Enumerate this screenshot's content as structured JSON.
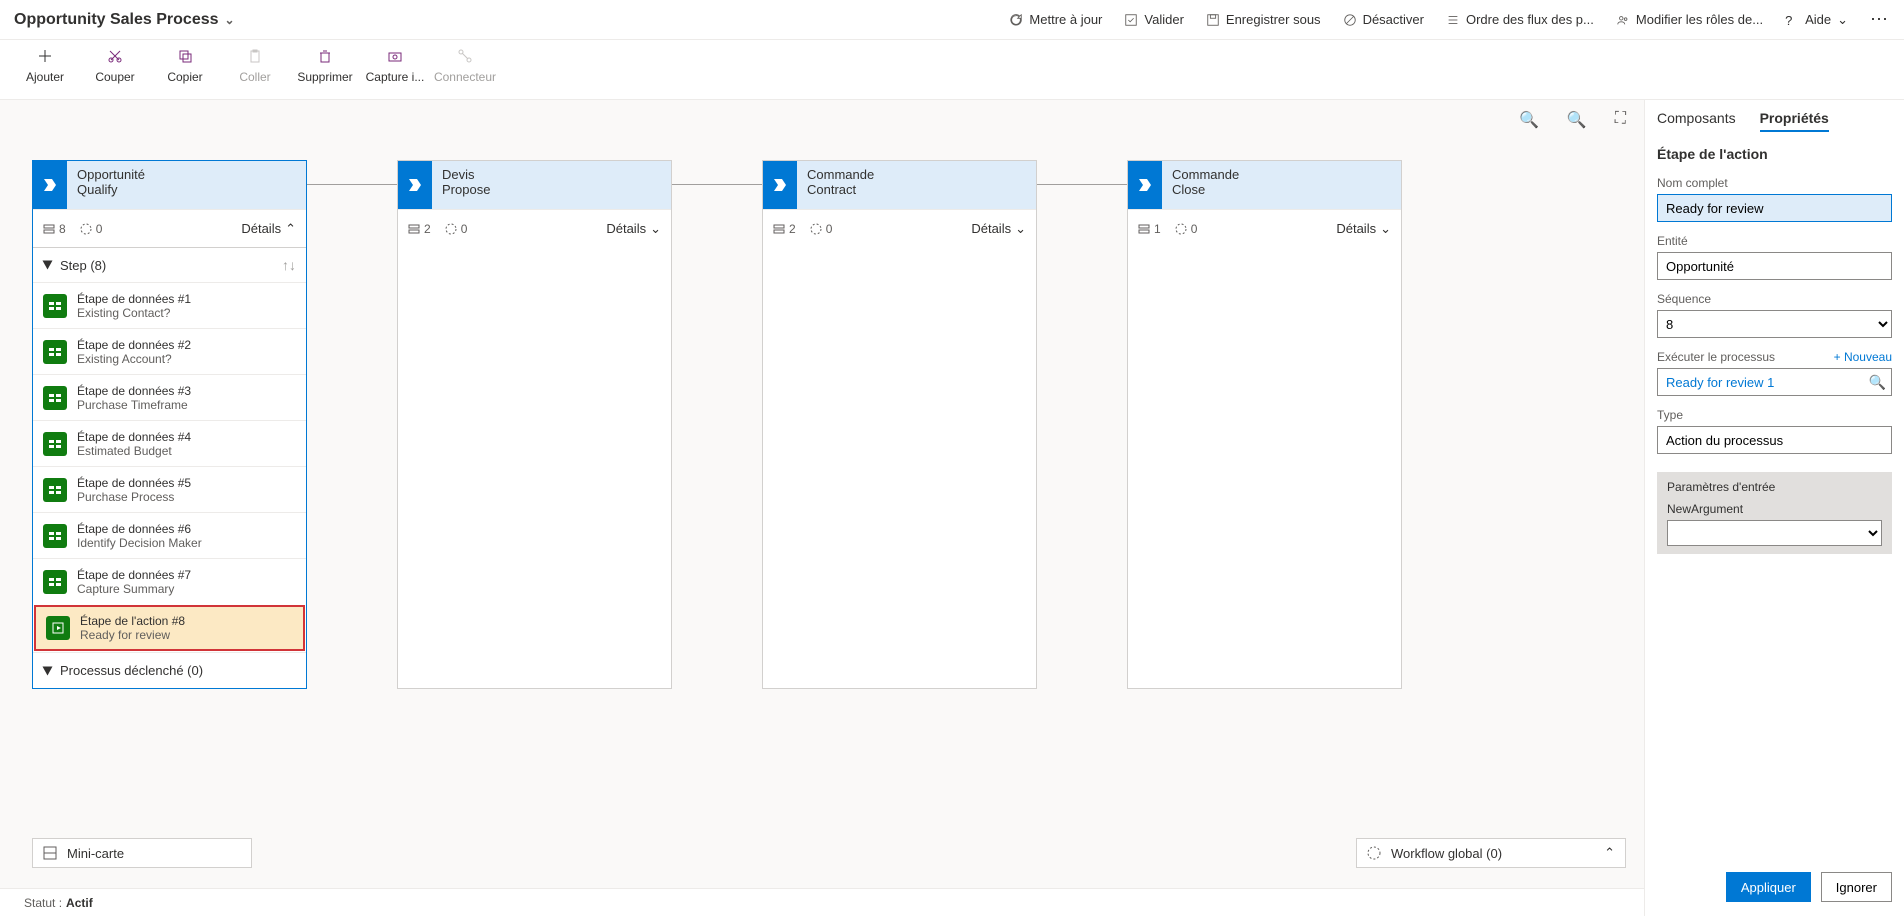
{
  "title": "Opportunity Sales Process",
  "topActions": {
    "refresh": "Mettre à jour",
    "validate": "Valider",
    "saveAs": "Enregistrer sous",
    "deactivate": "Désactiver",
    "order": "Ordre des flux des p...",
    "roles": "Modifier les rôles de...",
    "help": "Aide"
  },
  "toolbar": {
    "add": "Ajouter",
    "cut": "Couper",
    "copy": "Copier",
    "paste": "Coller",
    "delete": "Supprimer",
    "snapshot": "Capture i...",
    "connector": "Connecteur"
  },
  "stages": [
    {
      "entity": "Opportunité",
      "name": "Qualify",
      "steps": 8,
      "branches": 0,
      "details": "Détails",
      "expanded": true
    },
    {
      "entity": "Devis",
      "name": "Propose",
      "steps": 2,
      "branches": 0,
      "details": "Détails",
      "expanded": false
    },
    {
      "entity": "Commande",
      "name": "Contract",
      "steps": 2,
      "branches": 0,
      "details": "Détails",
      "expanded": false
    },
    {
      "entity": "Commande",
      "name": "Close",
      "steps": 1,
      "branches": 0,
      "details": "Détails",
      "expanded": false
    }
  ],
  "stepsHeader": "Step (8)",
  "steps": [
    {
      "title": "Étape de données #1",
      "sub": "Existing Contact?"
    },
    {
      "title": "Étape de données #2",
      "sub": "Existing Account?"
    },
    {
      "title": "Étape de données #3",
      "sub": "Purchase Timeframe"
    },
    {
      "title": "Étape de données #4",
      "sub": "Estimated Budget"
    },
    {
      "title": "Étape de données #5",
      "sub": "Purchase Process"
    },
    {
      "title": "Étape de données #6",
      "sub": "Identify Decision Maker"
    },
    {
      "title": "Étape de données #7",
      "sub": "Capture Summary"
    },
    {
      "title": "Étape de l'action #8",
      "sub": "Ready for review"
    }
  ],
  "triggered": "Processus déclenché (0)",
  "minimap": "Mini-carte",
  "workflow": "Workflow global (0)",
  "status": {
    "label": "Statut :",
    "value": "Actif"
  },
  "panel": {
    "tabComponents": "Composants",
    "tabProperties": "Propriétés",
    "title": "Étape de l'action",
    "fields": {
      "displayName": {
        "label": "Nom complet",
        "value": "Ready for review"
      },
      "entity": {
        "label": "Entité",
        "value": "Opportunité"
      },
      "sequence": {
        "label": "Séquence",
        "value": "8"
      },
      "execute": {
        "label": "Exécuter le processus",
        "link": "+ Nouveau",
        "placeholder": "Ready for review 1"
      },
      "type": {
        "label": "Type",
        "value": "Action du processus"
      }
    },
    "params": {
      "header": "Paramètres d'entrée",
      "arg": "NewArgument"
    },
    "apply": "Appliquer",
    "ignore": "Ignorer"
  }
}
